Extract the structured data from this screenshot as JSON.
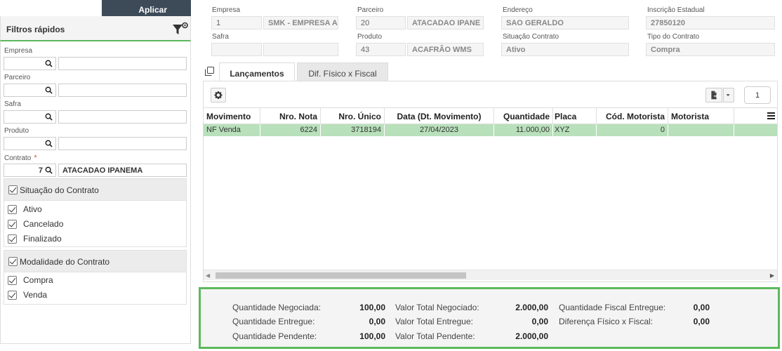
{
  "left_panel": {
    "apply_label": "Aplicar",
    "title": "Filtros rápidos",
    "fields": {
      "empresa": {
        "label": "Empresa",
        "code": "",
        "desc": ""
      },
      "parceiro": {
        "label": "Parceiro",
        "code": "",
        "desc": ""
      },
      "safra": {
        "label": "Safra",
        "code": "",
        "desc": ""
      },
      "produto": {
        "label": "Produto",
        "code": "",
        "desc": ""
      },
      "contrato": {
        "label": "Contrato",
        "required": "*",
        "code": "7",
        "desc": "ATACADAO IPANEMA"
      }
    },
    "situacao": {
      "header": "Situação do Contrato",
      "items": [
        "Ativo",
        "Cancelado",
        "Finalizado"
      ]
    },
    "modalidade": {
      "header": "Modalidade do Contrato",
      "items": [
        "Compra",
        "Venda"
      ]
    }
  },
  "header_fields": {
    "empresa": {
      "label": "Empresa",
      "code": "1",
      "desc": "SMK - EMPRESA A"
    },
    "parceiro": {
      "label": "Parceiro",
      "code": "20",
      "desc": "ATACADAO IPANE"
    },
    "endereco": {
      "label": "Endereço",
      "value": "SAO GERALDO"
    },
    "inscricao": {
      "label": "Inscrição Estadual",
      "value": "27850120"
    },
    "safra": {
      "label": "Safra",
      "code": "",
      "desc": ""
    },
    "produto": {
      "label": "Produto",
      "code": "43",
      "desc": "ACAFRÃO WMS"
    },
    "situacao": {
      "label": "Situação Contrato",
      "value": "Ativo"
    },
    "tipo": {
      "label": "Tipo do Contrato",
      "value": "Compra"
    }
  },
  "tabs": [
    {
      "label": "Lançamentos",
      "active": true
    },
    {
      "label": "Dif. Físico x Fiscal",
      "active": false
    }
  ],
  "grid": {
    "page": "1",
    "columns": [
      "Movimento",
      "Nro. Nota",
      "Nro. Único",
      "Data (Dt. Movimento)",
      "Quantidade",
      "Placa",
      "Cód. Motorista",
      "Motorista"
    ],
    "rows": [
      [
        "NF Venda",
        "6224",
        "3718194",
        "27/04/2023",
        "11.000,00",
        "XYZ",
        "0",
        ""
      ]
    ]
  },
  "totals": {
    "qtd_negociada": {
      "label": "Quantidade Negociada:",
      "value": "100,00"
    },
    "qtd_entregue": {
      "label": "Quantidade Entregue:",
      "value": "0,00"
    },
    "qtd_pendente": {
      "label": "Quantidade Pendente:",
      "value": "100,00"
    },
    "vt_negociado": {
      "label": "Valor Total Negociado:",
      "value": "2.000,00"
    },
    "vt_entregue": {
      "label": "Valor Total Entregue:",
      "value": "0,00"
    },
    "vt_pendente": {
      "label": "Valor Total Pendente:",
      "value": "2.000,00"
    },
    "qtd_fiscal": {
      "label": "Quantidade Fiscal Entregue:",
      "value": "0,00"
    },
    "dif_fisico": {
      "label": "Diferença Físico x Fiscal:",
      "value": "0,00"
    }
  },
  "colors": {
    "accent_green": "#5cb85c",
    "row_selected": "#b8e0bb",
    "apply_bg": "#3d4a58"
  }
}
